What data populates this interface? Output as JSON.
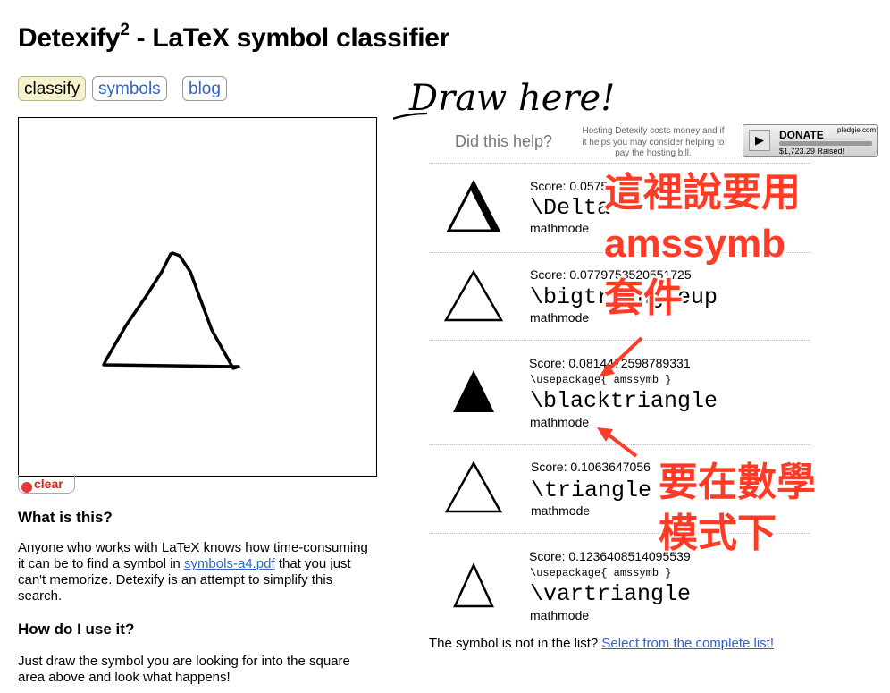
{
  "header": {
    "title": "Detexify",
    "title_sup": "2",
    "title_rest": " - LaTeX symbol classifier"
  },
  "nav": [
    {
      "label": "classify"
    },
    {
      "label": "symbols"
    },
    {
      "label": "blog"
    }
  ],
  "canvas": {
    "clear_label": "clear",
    "hint": "Draw here!"
  },
  "info": {
    "what_heading": "What is this?",
    "what_before": "Anyone who works with LaTeX knows how time-consuming it can be to find a symbol in ",
    "what_link": "symbols-a4.pdf",
    "what_after": " that you just can't memorize. Detexify is an attempt to simplify this search.",
    "how_heading": "How do I use it?",
    "how_text": "Just draw the symbol you are looking for into the square area above and look what happens!"
  },
  "help": {
    "question": "Did this help?",
    "hosting": "Hosting Detexify costs money and if it helps you may consider helping to pay the hosting bill.",
    "donate_label": "DONATE",
    "pledgie": "pledgie.com",
    "raised": "$1,723.29 Raised!"
  },
  "results": [
    {
      "score": "Score: 0.0575",
      "package": "",
      "command": "\\Delta",
      "mode": "mathmode"
    },
    {
      "score": "Score: 0.0779753520551725",
      "package": "",
      "command": "\\bigtriangleup",
      "mode": "mathmode"
    },
    {
      "score": "Score: 0.0814472598789331",
      "package": "\\usepackage{ amssymb }",
      "command": "\\blacktriangle",
      "mode": "mathmode"
    },
    {
      "score": "Score: 0.1063647056",
      "package": "",
      "command": "\\triangle",
      "mode": "mathmode"
    },
    {
      "score": "Score: 0.1236408514095539",
      "package": "\\usepackage{ amssymb }",
      "command": "\\vartriangle",
      "mode": "mathmode"
    }
  ],
  "bottom": {
    "text": "The symbol is not in the list? ",
    "link": "Select from the complete list!"
  },
  "annotations": {
    "a1": "這裡說要用",
    "a2": "amssymb",
    "a3": "套件",
    "b1": "要在數學",
    "b2": "模式下"
  },
  "colors": {
    "link": "#2f63c6",
    "annotation": "#ff3b26",
    "active_tab": "#f6f2cf",
    "clear": "#dd2222"
  }
}
